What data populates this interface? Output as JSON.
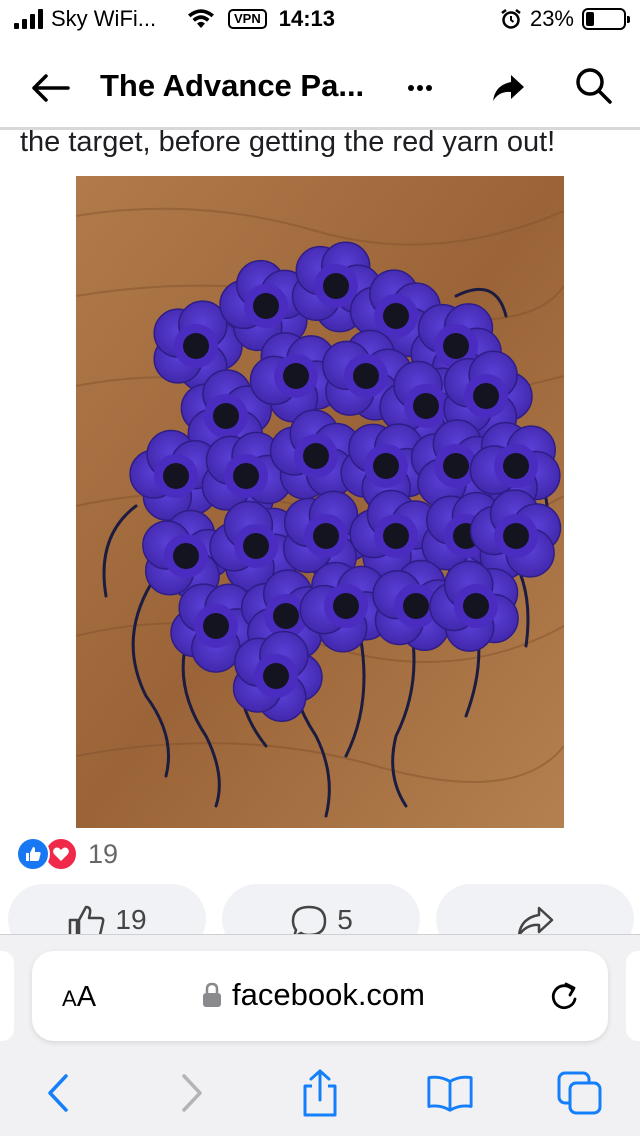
{
  "status_bar": {
    "carrier": "Sky WiFi...",
    "vpn": "VPN",
    "time": "14:13",
    "battery": "23%",
    "battery_level": 0.23
  },
  "header": {
    "title": "The Advance Pa...",
    "icons": [
      "back-arrow-icon",
      "more-dots-icon",
      "share-arrow-icon",
      "search-icon"
    ]
  },
  "post": {
    "text": "the target, before getting the red yarn out!",
    "photo_icon": "crochet-poppies-photo"
  },
  "reactions": {
    "count": "19",
    "icons": [
      "like-reaction-icon",
      "love-reaction-icon"
    ]
  },
  "actions": {
    "like_count": "19",
    "comment_count": "5",
    "icons": [
      "thumbs-up-icon",
      "comment-bubble-icon",
      "share-icon"
    ]
  },
  "browser": {
    "aa_big": "A",
    "aa_small": "A",
    "url": "facebook.com",
    "icons": [
      "lock-icon",
      "reload-icon",
      "back-chevron-icon",
      "forward-chevron-icon",
      "share-sheet-icon",
      "bookmarks-icon",
      "tabs-icon"
    ]
  },
  "colors": {
    "like_blue": "#1877f2",
    "love_red": "#f02849",
    "safari_blue": "#147efb",
    "pill_bg": "#f0f2f5",
    "yarn_purple": "#4b2cc0"
  }
}
